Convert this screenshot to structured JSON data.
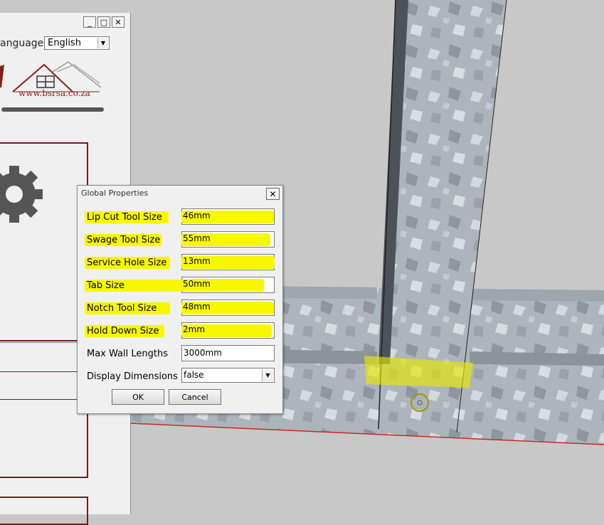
{
  "window": {
    "minimize_glyph": "_",
    "maximize_glyph": "□",
    "close_glyph": "✕"
  },
  "sidebar": {
    "language_label": "anguage",
    "language_value": "English",
    "logo_text": "www.bsrsa.co.za"
  },
  "dialog": {
    "title": "Global Properties",
    "close_glyph": "✕",
    "fields": [
      {
        "label": "Lip Cut Tool Size",
        "value": "46mm",
        "highlighted": true
      },
      {
        "label": "Swage Tool Size",
        "value": "55mm",
        "highlighted": true
      },
      {
        "label": "Service Hole Size",
        "value": "13mm",
        "highlighted": true
      },
      {
        "label": "Tab Size",
        "value": "50mm",
        "highlighted": true
      },
      {
        "label": "Notch Tool Size",
        "value": "48mm",
        "highlighted": true
      },
      {
        "label": "Hold Down Size",
        "value": "2mm",
        "highlighted": true
      },
      {
        "label": "Max Wall Lengths",
        "value": "3000mm",
        "highlighted": false
      },
      {
        "label": "Display Dimensions",
        "value": "false",
        "highlighted": false
      }
    ],
    "ok_label": "OK",
    "cancel_label": "Cancel"
  },
  "colors": {
    "highlight": "#f7f700",
    "brand_red": "#8a1c1c",
    "frame_red": "#6e1f1f"
  }
}
